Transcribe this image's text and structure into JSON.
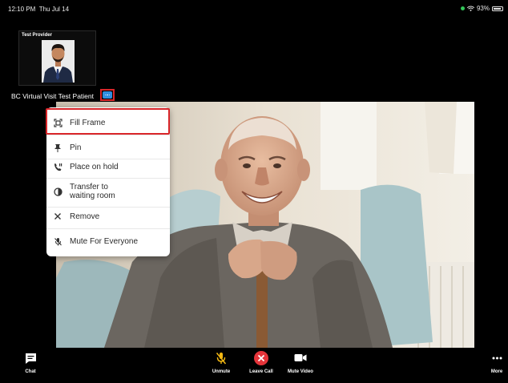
{
  "status_bar": {
    "time": "12:10 PM",
    "date": "Thu Jul 14",
    "battery_text": "93%"
  },
  "self_view": {
    "label": "Test Provider"
  },
  "patient": {
    "name": "BC Virtual Visit Test Patient"
  },
  "menu": {
    "items": [
      {
        "label": "Fill Frame",
        "icon": "fill-frame-icon"
      },
      {
        "label": "Pin",
        "icon": "pin-icon"
      },
      {
        "label": "Place on hold",
        "icon": "hold-call-icon"
      },
      {
        "label": "Transfer to",
        "label2": "waiting room",
        "icon": "transfer-icon"
      },
      {
        "label": "Remove",
        "icon": "close-icon"
      },
      {
        "label": "Mute For Everyone",
        "icon": "mute-everyone-icon"
      }
    ]
  },
  "toolbar": {
    "chat": "Chat",
    "unmute": "Unmute",
    "leave_call": "Leave Call",
    "mute_video": "Mute Video",
    "more": "More"
  },
  "colors": {
    "accent_blue": "#2f8ee0",
    "highlight_red": "#d9262a",
    "leave_red": "#e5343a",
    "mic_yellow": "#f2b713",
    "status_green": "#33c759"
  }
}
